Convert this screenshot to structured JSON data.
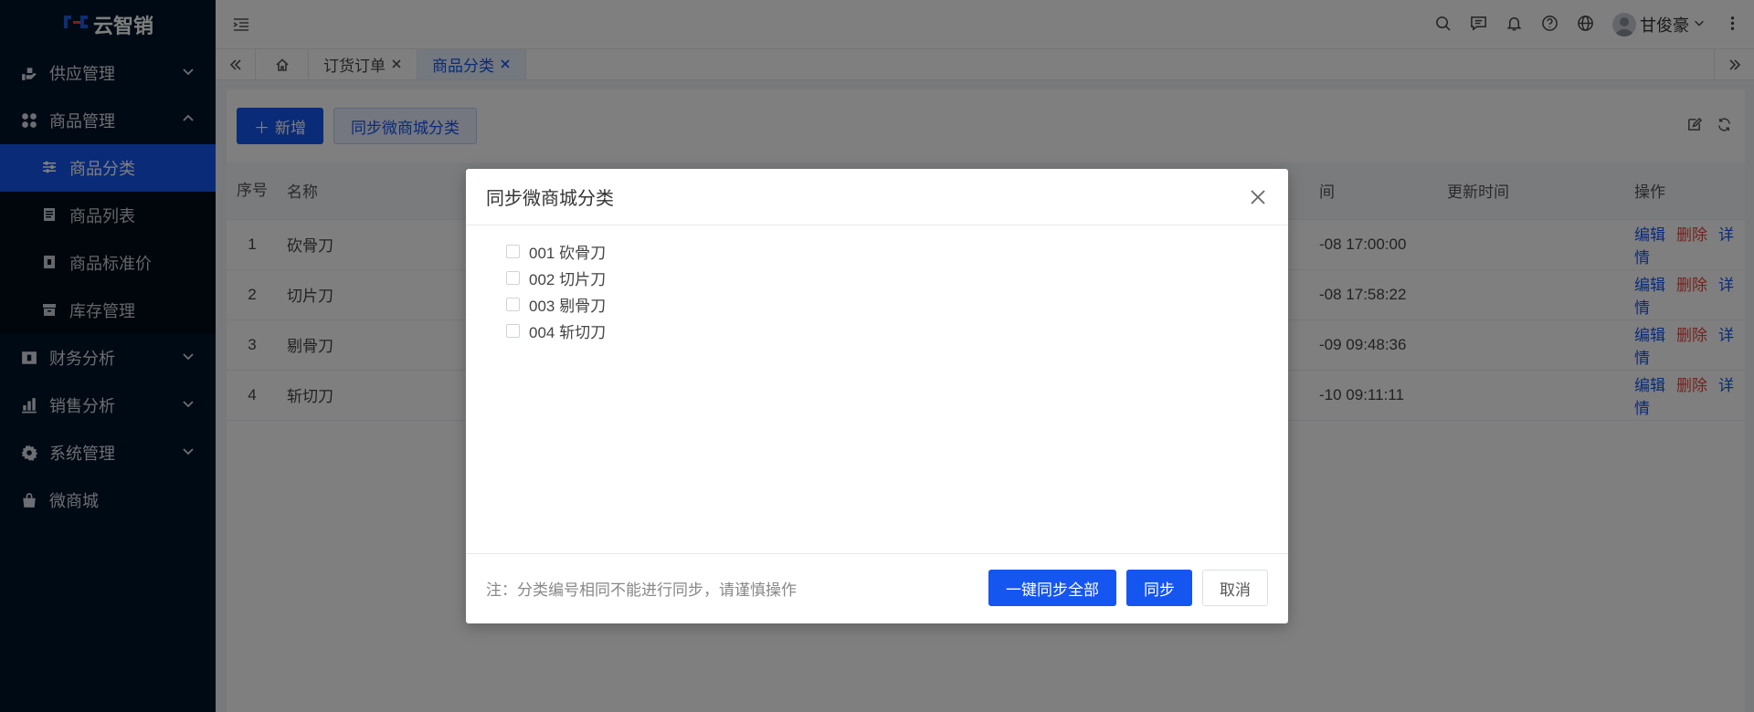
{
  "app": {
    "logo_text": "云智销"
  },
  "sidebar": {
    "items": [
      {
        "label": "供应管理",
        "icon": "supply-icon"
      },
      {
        "label": "商品管理",
        "icon": "goods-icon"
      },
      {
        "label": "财务分析",
        "icon": "finance-icon"
      },
      {
        "label": "销售分析",
        "icon": "sales-chart-icon"
      },
      {
        "label": "系统管理",
        "icon": "gear-icon"
      },
      {
        "label": "微商城",
        "icon": "shop-bag-icon"
      }
    ],
    "submenu": [
      {
        "label": "商品分类",
        "icon": "sliders-icon",
        "active": true
      },
      {
        "label": "商品列表",
        "icon": "document-icon"
      },
      {
        "label": "商品标准价",
        "icon": "price-tag-icon"
      },
      {
        "label": "库存管理",
        "icon": "warehouse-icon"
      }
    ]
  },
  "header": {
    "user_name": "甘俊豪"
  },
  "tabs": [
    {
      "label": "订货订单"
    },
    {
      "label": "商品分类"
    }
  ],
  "toolbar": {
    "add_label": "新增",
    "sync_label": "同步微商城分类"
  },
  "table": {
    "headers": {
      "no": "序号",
      "name": "名称",
      "create_time": "间",
      "update_time": "更新时间",
      "actions": "操作"
    },
    "actions": {
      "edit": "编辑",
      "delete": "删除",
      "detail": "详情"
    },
    "rows": [
      {
        "no": "1",
        "name": "砍骨刀",
        "create_time": "-08 17:00:00",
        "update_time": ""
      },
      {
        "no": "2",
        "name": "切片刀",
        "create_time": "-08 17:58:22",
        "update_time": ""
      },
      {
        "no": "3",
        "name": "剔骨刀",
        "create_time": "-09 09:48:36",
        "update_time": ""
      },
      {
        "no": "4",
        "name": "斩切刀",
        "create_time": "-10 09:11:11",
        "update_time": ""
      }
    ]
  },
  "dialog": {
    "title": "同步微商城分类",
    "items": [
      "001 砍骨刀",
      "002 切片刀",
      "003 剔骨刀",
      "004 斩切刀"
    ],
    "note": "注：分类编号相同不能进行同步，请谨慎操作",
    "sync_all_label": "一键同步全部",
    "sync_label": "同步",
    "cancel_label": "取消"
  }
}
